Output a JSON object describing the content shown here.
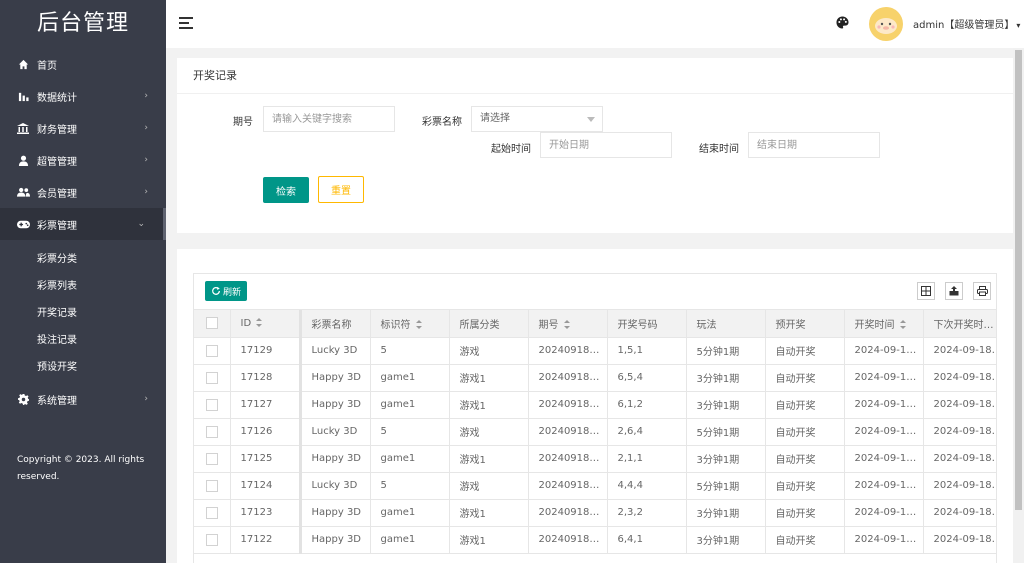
{
  "app": {
    "logo": "后台管理"
  },
  "sidebar": {
    "items": [
      {
        "label": "首页",
        "icon": "home-icon",
        "arrow": ""
      },
      {
        "label": "数据统计",
        "icon": "bar-chart-icon",
        "arrow": "›"
      },
      {
        "label": "财务管理",
        "icon": "bank-icon",
        "arrow": "›"
      },
      {
        "label": "超管管理",
        "icon": "user-icon",
        "arrow": "›"
      },
      {
        "label": "会员管理",
        "icon": "group-icon",
        "arrow": "›"
      },
      {
        "label": "彩票管理",
        "icon": "gamepad-icon",
        "arrow": "⌄"
      }
    ],
    "sub_items": [
      "彩票分类",
      "彩票列表",
      "开奖记录",
      "投注记录",
      "预设开奖"
    ],
    "items_after": [
      {
        "label": "系统管理",
        "icon": "gear-icon",
        "arrow": "›"
      }
    ],
    "copyright": "Copyright © 2023. All rights reserved."
  },
  "header": {
    "user": "admin【超级管理员】",
    "caret": "▾"
  },
  "search": {
    "title": "开奖记录",
    "period_label": "期号",
    "period_placeholder": "请输入关键字搜索",
    "lottery_label": "彩票名称",
    "lottery_value": "请选择",
    "start_label": "起始时间",
    "start_placeholder": "开始日期",
    "end_label": "结束时间",
    "end_placeholder": "结束日期",
    "search_btn": "检索",
    "reset_btn": "重置"
  },
  "table": {
    "refresh_label": "刷新",
    "columns": [
      "ID",
      "彩票名称",
      "标识符",
      "所属分类",
      "期号",
      "开奖号码",
      "玩法",
      "预开奖",
      "开奖时间",
      "下次开奖时…"
    ],
    "rows": [
      [
        "17129",
        "Lucky 3D",
        "5",
        "游戏",
        "20240918…",
        "1,5,1",
        "5分钟1期",
        "自动开奖",
        "2024-09-1…",
        "2024-09-18…"
      ],
      [
        "17128",
        "Happy 3D",
        "game1",
        "游戏1",
        "20240918…",
        "6,5,4",
        "3分钟1期",
        "自动开奖",
        "2024-09-1…",
        "2024-09-18…"
      ],
      [
        "17127",
        "Happy 3D",
        "game1",
        "游戏1",
        "20240918…",
        "6,1,2",
        "3分钟1期",
        "自动开奖",
        "2024-09-1…",
        "2024-09-18…"
      ],
      [
        "17126",
        "Lucky 3D",
        "5",
        "游戏",
        "20240918…",
        "2,6,4",
        "5分钟1期",
        "自动开奖",
        "2024-09-1…",
        "2024-09-18…"
      ],
      [
        "17125",
        "Happy 3D",
        "game1",
        "游戏1",
        "20240918…",
        "2,1,1",
        "3分钟1期",
        "自动开奖",
        "2024-09-1…",
        "2024-09-18…"
      ],
      [
        "17124",
        "Lucky 3D",
        "5",
        "游戏",
        "20240918…",
        "4,4,4",
        "5分钟1期",
        "自动开奖",
        "2024-09-1…",
        "2024-09-18…"
      ],
      [
        "17123",
        "Happy 3D",
        "game1",
        "游戏1",
        "20240918…",
        "2,3,2",
        "3分钟1期",
        "自动开奖",
        "2024-09-1…",
        "2024-09-18…"
      ],
      [
        "17122",
        "Happy 3D",
        "game1",
        "游戏1",
        "20240918…",
        "6,4,1",
        "3分钟1期",
        "自动开奖",
        "2024-09-1…",
        "2024-09-18…"
      ]
    ]
  },
  "colors": {
    "primary": "#009688",
    "warn": "#ffb800",
    "sidebar": "#393d49"
  }
}
